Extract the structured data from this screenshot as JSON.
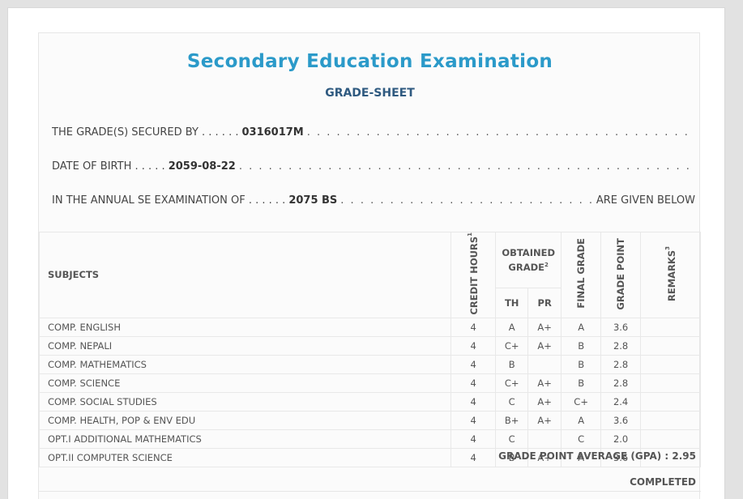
{
  "header": {
    "title": "Secondary Education Examination",
    "subtitle": "GRADE-SHEET"
  },
  "info": {
    "secured_label": "THE GRADE(S) SECURED BY . . . . . .",
    "symbol_no": "0316017M",
    "dob_label": "DATE OF BIRTH . . . . .",
    "dob": "2059-08-22",
    "exam_label": "IN THE ANNUAL SE EXAMINATION OF . . . . . .",
    "exam_year": "2075 BS",
    "exam_tail": "ARE GIVEN BELOW"
  },
  "table": {
    "headers": {
      "subjects": "SUBJECTS",
      "credit_hours": "CREDIT HOURS",
      "credit_sup": "1",
      "obtained_grade": "OBTAINED GRADE",
      "obtained_sup": "2",
      "th": "TH",
      "pr": "PR",
      "final_grade": "FINAL GRADE",
      "grade_point": "GRADE POINT",
      "remarks": "REMARKS",
      "remarks_sup": "3"
    },
    "rows": [
      {
        "subject": "COMP. ENGLISH",
        "credit": "4",
        "th": "A",
        "pr": "A+",
        "final": "A",
        "gp": "3.6",
        "remarks": ""
      },
      {
        "subject": "COMP. NEPALI",
        "credit": "4",
        "th": "C+",
        "pr": "A+",
        "final": "B",
        "gp": "2.8",
        "remarks": ""
      },
      {
        "subject": "COMP. MATHEMATICS",
        "credit": "4",
        "th": "B",
        "pr": "",
        "final": "B",
        "gp": "2.8",
        "remarks": ""
      },
      {
        "subject": "COMP. SCIENCE",
        "credit": "4",
        "th": "C+",
        "pr": "A+",
        "final": "B",
        "gp": "2.8",
        "remarks": ""
      },
      {
        "subject": "COMP. SOCIAL STUDIES",
        "credit": "4",
        "th": "C",
        "pr": "A+",
        "final": "C+",
        "gp": "2.4",
        "remarks": ""
      },
      {
        "subject": "COMP. HEALTH, POP & ENV EDU",
        "credit": "4",
        "th": "B+",
        "pr": "A+",
        "final": "A",
        "gp": "3.6",
        "remarks": ""
      },
      {
        "subject": "OPT.I ADDITIONAL MATHEMATICS",
        "credit": "4",
        "th": "C",
        "pr": "",
        "final": "C",
        "gp": "2.0",
        "remarks": ""
      },
      {
        "subject": "OPT.II COMPUTER SCIENCE",
        "credit": "4",
        "th": "B",
        "pr": "A+",
        "final": "A",
        "gp": "3.6",
        "remarks": ""
      }
    ]
  },
  "summary": {
    "gpa_text": "GRADE POINT AVERAGE (GPA) : 2.95",
    "status": "COMPLETED"
  },
  "colors": {
    "title": "#2b9ac9",
    "subtitle": "#2f5a80",
    "background": "#e2e2e2"
  }
}
